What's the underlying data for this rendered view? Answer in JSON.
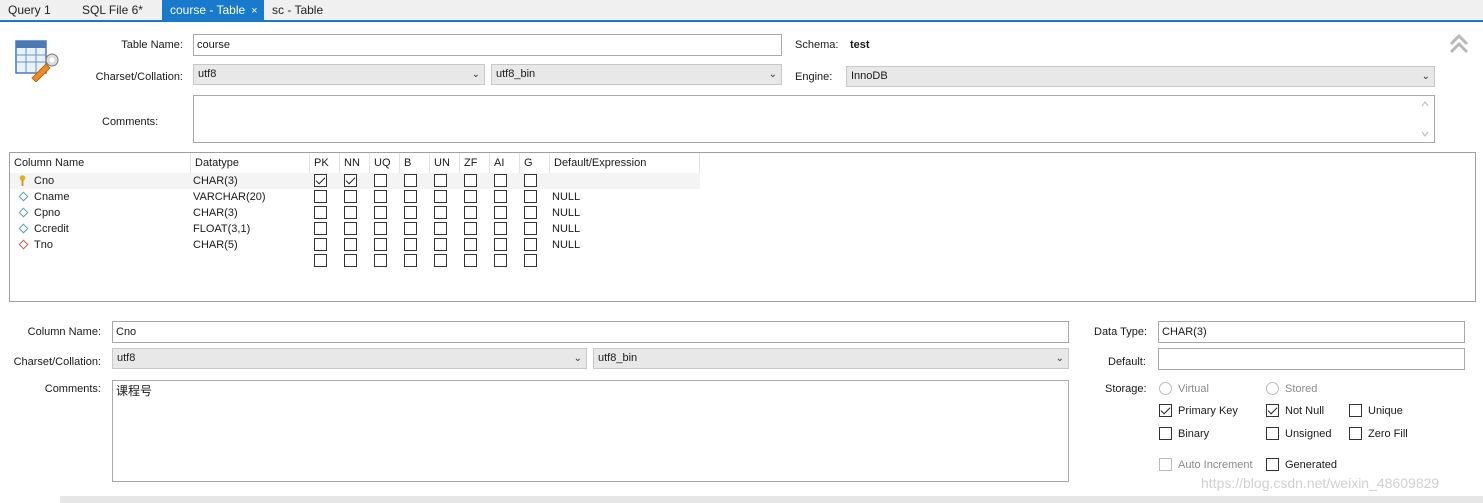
{
  "tabs": [
    {
      "label": "Query 1"
    },
    {
      "label": "SQL File 6*"
    },
    {
      "label": "course - Table",
      "close": "×"
    },
    {
      "label": "sc - Table"
    }
  ],
  "table": {
    "name_label": "Table Name:",
    "name_value": "course",
    "schema_label": "Schema:",
    "schema_value": "test",
    "charset_label": "Charset/Collation:",
    "charset_value": "utf8",
    "collation_value": "utf8_bin",
    "engine_label": "Engine:",
    "engine_value": "InnoDB",
    "comments_label": "Comments:",
    "comments_value": ""
  },
  "grid": {
    "headers": [
      "Column Name",
      "Datatype",
      "PK",
      "NN",
      "UQ",
      "B",
      "UN",
      "ZF",
      "AI",
      "G",
      "Default/Expression"
    ],
    "rows": [
      {
        "name": "Cno",
        "type": "CHAR(3)",
        "default": "",
        "icon": "primary-key-icon",
        "flags": [
          true,
          true,
          false,
          false,
          false,
          false,
          false,
          false
        ]
      },
      {
        "name": "Cname",
        "type": "VARCHAR(20)",
        "default": "NULL",
        "icon": "column-diamond-icon",
        "flags": [
          false,
          false,
          false,
          false,
          false,
          false,
          false,
          false
        ]
      },
      {
        "name": "Cpno",
        "type": "CHAR(3)",
        "default": "NULL",
        "icon": "column-diamond-icon",
        "flags": [
          false,
          false,
          false,
          false,
          false,
          false,
          false,
          false
        ]
      },
      {
        "name": "Ccredit",
        "type": "FLOAT(3,1)",
        "default": "NULL",
        "icon": "column-diamond-icon",
        "flags": [
          false,
          false,
          false,
          false,
          false,
          false,
          false,
          false
        ]
      },
      {
        "name": "Tno",
        "type": "CHAR(5)",
        "default": "NULL",
        "icon": "foreign-key-diamond-icon",
        "flags": [
          false,
          false,
          false,
          false,
          false,
          false,
          false,
          false
        ]
      },
      {
        "name": "",
        "type": "",
        "default": "",
        "icon": "",
        "flags": [
          false,
          false,
          false,
          false,
          false,
          false,
          false,
          false
        ]
      }
    ]
  },
  "column": {
    "name_label": "Column Name:",
    "name_value": "Cno",
    "charset_label": "Charset/Collation:",
    "charset_value": "utf8",
    "collation_value": "utf8_bin",
    "comments_label": "Comments:",
    "comments_value": "课程号",
    "datatype_label": "Data Type:",
    "datatype_value": "CHAR(3)",
    "default_label": "Default:",
    "default_value": "",
    "storage_label": "Storage:",
    "virtual_label": "Virtual",
    "stored_label": "Stored",
    "primary_key_label": "Primary Key",
    "not_null_label": "Not Null",
    "unique_label": "Unique",
    "binary_label": "Binary",
    "unsigned_label": "Unsigned",
    "zero_fill_label": "Zero Fill",
    "auto_increment_label": "Auto Increment",
    "generated_label": "Generated",
    "primary_key_checked": true,
    "not_null_checked": true
  },
  "watermark": "https://blog.csdn.net/weixin_48609829",
  "colors": {
    "accent": "#1979ca"
  }
}
